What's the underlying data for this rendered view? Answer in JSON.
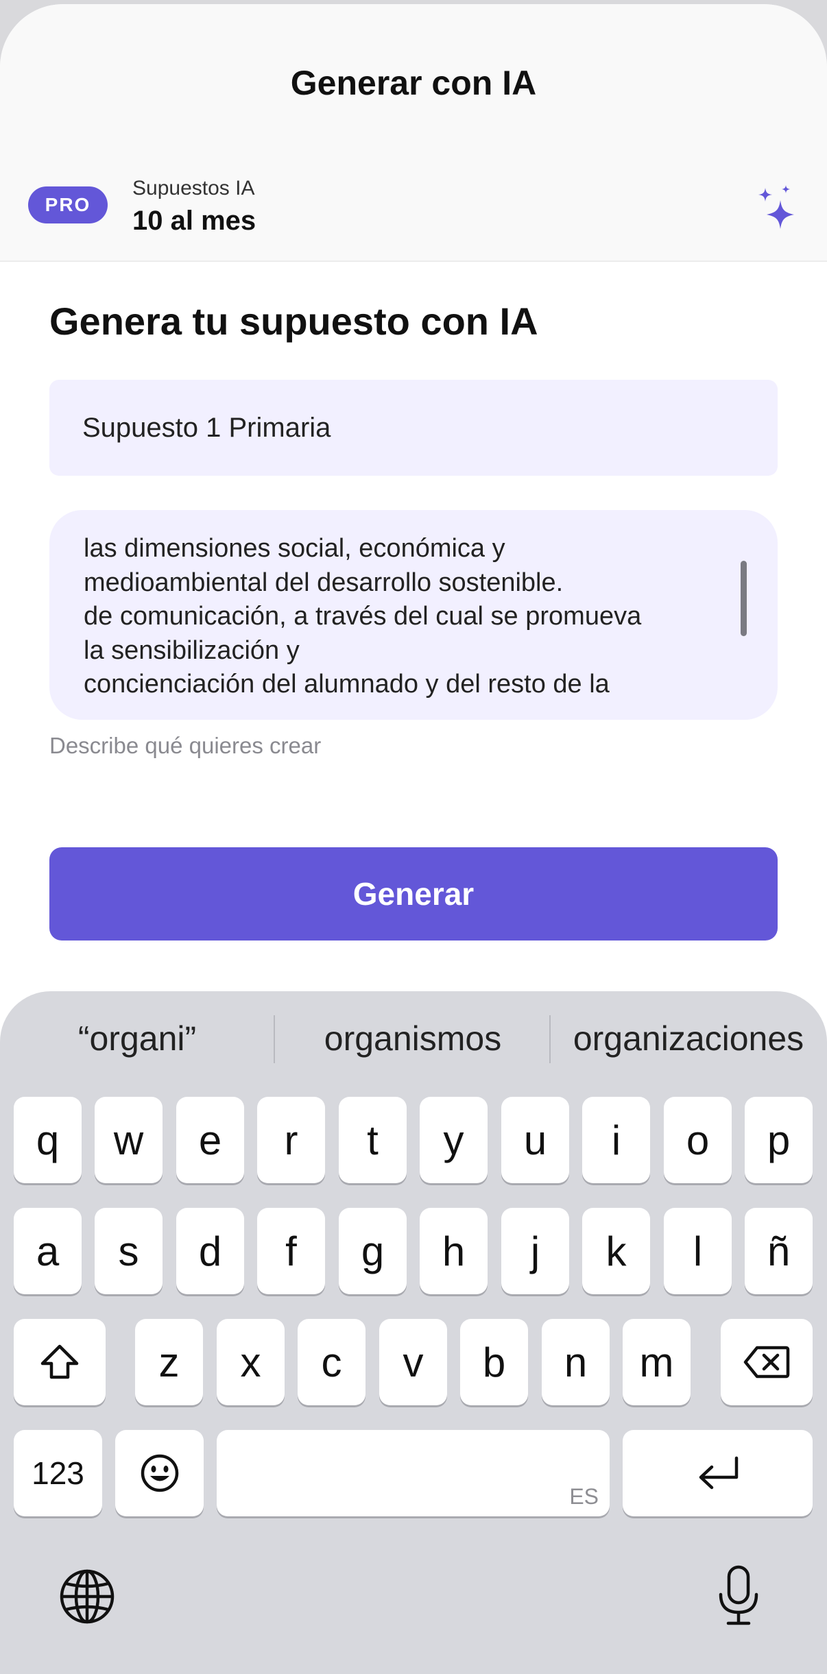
{
  "header": {
    "title": "Generar con IA"
  },
  "plan": {
    "badge": "PRO",
    "label": "Supuestos IA",
    "value": "10 al mes",
    "icon": "sparkles-icon"
  },
  "form": {
    "heading": "Genera tu supuesto con IA",
    "title_value": "Supuesto 1 Primaria",
    "description_lines": [
      "las dimensiones social, económica y",
      "medioambiental del desarrollo sostenible.",
      "de comunicación, a través del cual se promueva",
      "la sensibilización y",
      "concienciación del alumnado y del resto de la"
    ],
    "helper": "Describe qué quieres crear",
    "button": "Generar"
  },
  "colors": {
    "accent": "#6357d8",
    "field_bg": "#f2f0ff"
  },
  "keyboard": {
    "suggestions": [
      "“organi”",
      "organismos",
      "organizaciones"
    ],
    "row1": [
      "q",
      "w",
      "e",
      "r",
      "t",
      "y",
      "u",
      "i",
      "o",
      "p"
    ],
    "row2": [
      "a",
      "s",
      "d",
      "f",
      "g",
      "h",
      "j",
      "k",
      "l",
      "ñ"
    ],
    "row3": [
      "z",
      "x",
      "c",
      "v",
      "b",
      "n",
      "m"
    ],
    "numbers_key": "123",
    "space_lang": "ES",
    "icons": [
      "shift-icon",
      "backspace-icon",
      "emoji-icon",
      "return-icon",
      "globe-icon",
      "microphone-icon"
    ]
  }
}
